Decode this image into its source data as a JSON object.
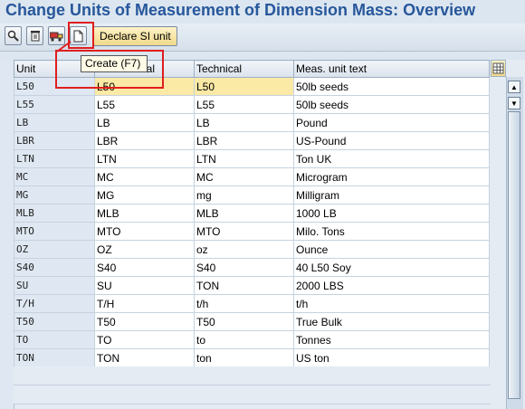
{
  "title": "Change Units of Measurement of Dimension Mass: Overview",
  "toolbar": {
    "declare_si_unit_label": "Declare SI unit",
    "tooltip": "Create   (F7)"
  },
  "table": {
    "headers": [
      "Unit",
      "Commercial",
      "Technical",
      "Meas. unit text"
    ],
    "rows": [
      [
        "L50",
        "L50",
        "L50",
        "50lb seeds"
      ],
      [
        "L55",
        "L55",
        "L55",
        "50lb seeds"
      ],
      [
        "LB",
        "LB",
        "LB",
        "Pound"
      ],
      [
        "LBR",
        "LBR",
        "LBR",
        "US-Pound"
      ],
      [
        "LTN",
        "LTN",
        "LTN",
        "Ton UK"
      ],
      [
        "MC",
        "MC",
        "MC",
        "Microgram"
      ],
      [
        "MG",
        "MG",
        "mg",
        "Milligram"
      ],
      [
        "MLB",
        "MLB",
        "MLB",
        "1000 LB"
      ],
      [
        "MTO",
        "MTO",
        "MTO",
        "Milo. Tons"
      ],
      [
        "OZ",
        "OZ",
        "oz",
        "Ounce"
      ],
      [
        "S40",
        "S40",
        "S40",
        "40 L50 Soy"
      ],
      [
        "SU",
        "SU",
        "TON",
        "2000 LBS"
      ],
      [
        "T/H",
        "T/H",
        "t/h",
        "t/h"
      ],
      [
        "T50",
        "T50",
        "T50",
        "True Bulk"
      ],
      [
        "TO",
        "TO",
        "to",
        "Tonnes"
      ],
      [
        "TON",
        "TON",
        "ton",
        "US ton"
      ]
    ]
  },
  "colors": {
    "title": "#27579b",
    "annotation": "#e01e1e",
    "highlight": "#fbe9a6"
  }
}
